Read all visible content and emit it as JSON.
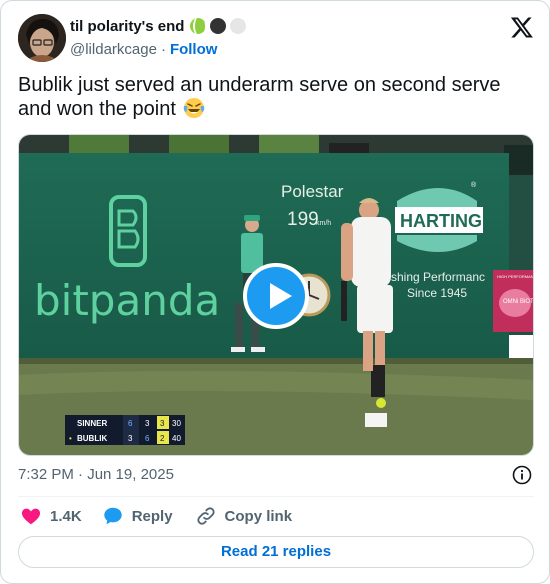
{
  "author": {
    "display_name": "til polarity's end",
    "handle": "@lildarkcage",
    "separator": "·",
    "follow_label": "Follow",
    "name_emojis": [
      "tennis-ball-emoji",
      "black-circle-emoji",
      "white-circle-emoji"
    ]
  },
  "tweet": {
    "text": "Bublik just served an underarm serve on second serve and won the point",
    "trailing_emoji": "laughing-with-tears-emoji"
  },
  "media": {
    "type": "video",
    "signage": {
      "sponsor_left": "bitpanda",
      "speed_brand": "Polestar",
      "speed_value": "199",
      "speed_unit": "km/h",
      "sponsor_right": "HARTING",
      "sponsor_right_tagline": "shing Performanc",
      "sponsor_right_year": "Since 1945",
      "side_banner_1": "HIGH PERFORMANCE PROBIOTICS",
      "side_banner_2": "OMNi BiOTiC"
    },
    "scoreboard": [
      {
        "player": "SINNER",
        "serving": false,
        "sets": [
          "6",
          "3",
          "3"
        ],
        "points": "30"
      },
      {
        "player": "BUBLIK",
        "serving": true,
        "sets": [
          "3",
          "6",
          "2"
        ],
        "points": "40"
      }
    ]
  },
  "meta": {
    "timestamp": "7:32 PM · Jun 19, 2025"
  },
  "actions": {
    "like_count": "1.4K",
    "reply_label": "Reply",
    "copy_label": "Copy link"
  },
  "footer": {
    "read_replies_label": "Read 21 replies"
  },
  "colors": {
    "accent": "#1d9bf0",
    "link": "#006fd6",
    "like": "#f91880",
    "secondary_text": "#536471",
    "border": "#cfd9de"
  }
}
